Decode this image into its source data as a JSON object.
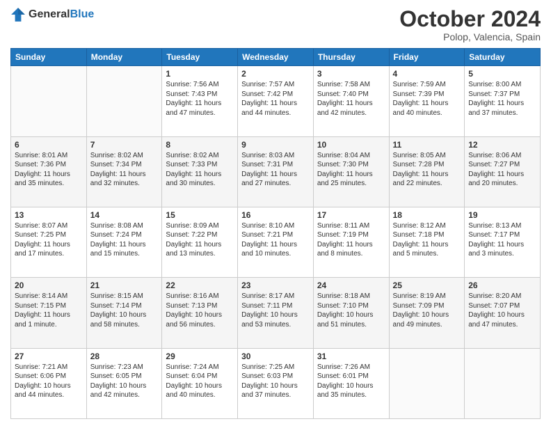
{
  "logo": {
    "text_general": "General",
    "text_blue": "Blue"
  },
  "header": {
    "month": "October 2024",
    "location": "Polop, Valencia, Spain"
  },
  "weekdays": [
    "Sunday",
    "Monday",
    "Tuesday",
    "Wednesday",
    "Thursday",
    "Friday",
    "Saturday"
  ],
  "weeks": [
    [
      {
        "day": "",
        "info": ""
      },
      {
        "day": "",
        "info": ""
      },
      {
        "day": "1",
        "info": "Sunrise: 7:56 AM\nSunset: 7:43 PM\nDaylight: 11 hours and 47 minutes."
      },
      {
        "day": "2",
        "info": "Sunrise: 7:57 AM\nSunset: 7:42 PM\nDaylight: 11 hours and 44 minutes."
      },
      {
        "day": "3",
        "info": "Sunrise: 7:58 AM\nSunset: 7:40 PM\nDaylight: 11 hours and 42 minutes."
      },
      {
        "day": "4",
        "info": "Sunrise: 7:59 AM\nSunset: 7:39 PM\nDaylight: 11 hours and 40 minutes."
      },
      {
        "day": "5",
        "info": "Sunrise: 8:00 AM\nSunset: 7:37 PM\nDaylight: 11 hours and 37 minutes."
      }
    ],
    [
      {
        "day": "6",
        "info": "Sunrise: 8:01 AM\nSunset: 7:36 PM\nDaylight: 11 hours and 35 minutes."
      },
      {
        "day": "7",
        "info": "Sunrise: 8:02 AM\nSunset: 7:34 PM\nDaylight: 11 hours and 32 minutes."
      },
      {
        "day": "8",
        "info": "Sunrise: 8:02 AM\nSunset: 7:33 PM\nDaylight: 11 hours and 30 minutes."
      },
      {
        "day": "9",
        "info": "Sunrise: 8:03 AM\nSunset: 7:31 PM\nDaylight: 11 hours and 27 minutes."
      },
      {
        "day": "10",
        "info": "Sunrise: 8:04 AM\nSunset: 7:30 PM\nDaylight: 11 hours and 25 minutes."
      },
      {
        "day": "11",
        "info": "Sunrise: 8:05 AM\nSunset: 7:28 PM\nDaylight: 11 hours and 22 minutes."
      },
      {
        "day": "12",
        "info": "Sunrise: 8:06 AM\nSunset: 7:27 PM\nDaylight: 11 hours and 20 minutes."
      }
    ],
    [
      {
        "day": "13",
        "info": "Sunrise: 8:07 AM\nSunset: 7:25 PM\nDaylight: 11 hours and 17 minutes."
      },
      {
        "day": "14",
        "info": "Sunrise: 8:08 AM\nSunset: 7:24 PM\nDaylight: 11 hours and 15 minutes."
      },
      {
        "day": "15",
        "info": "Sunrise: 8:09 AM\nSunset: 7:22 PM\nDaylight: 11 hours and 13 minutes."
      },
      {
        "day": "16",
        "info": "Sunrise: 8:10 AM\nSunset: 7:21 PM\nDaylight: 11 hours and 10 minutes."
      },
      {
        "day": "17",
        "info": "Sunrise: 8:11 AM\nSunset: 7:19 PM\nDaylight: 11 hours and 8 minutes."
      },
      {
        "day": "18",
        "info": "Sunrise: 8:12 AM\nSunset: 7:18 PM\nDaylight: 11 hours and 5 minutes."
      },
      {
        "day": "19",
        "info": "Sunrise: 8:13 AM\nSunset: 7:17 PM\nDaylight: 11 hours and 3 minutes."
      }
    ],
    [
      {
        "day": "20",
        "info": "Sunrise: 8:14 AM\nSunset: 7:15 PM\nDaylight: 11 hours and 1 minute."
      },
      {
        "day": "21",
        "info": "Sunrise: 8:15 AM\nSunset: 7:14 PM\nDaylight: 10 hours and 58 minutes."
      },
      {
        "day": "22",
        "info": "Sunrise: 8:16 AM\nSunset: 7:13 PM\nDaylight: 10 hours and 56 minutes."
      },
      {
        "day": "23",
        "info": "Sunrise: 8:17 AM\nSunset: 7:11 PM\nDaylight: 10 hours and 53 minutes."
      },
      {
        "day": "24",
        "info": "Sunrise: 8:18 AM\nSunset: 7:10 PM\nDaylight: 10 hours and 51 minutes."
      },
      {
        "day": "25",
        "info": "Sunrise: 8:19 AM\nSunset: 7:09 PM\nDaylight: 10 hours and 49 minutes."
      },
      {
        "day": "26",
        "info": "Sunrise: 8:20 AM\nSunset: 7:07 PM\nDaylight: 10 hours and 47 minutes."
      }
    ],
    [
      {
        "day": "27",
        "info": "Sunrise: 7:21 AM\nSunset: 6:06 PM\nDaylight: 10 hours and 44 minutes."
      },
      {
        "day": "28",
        "info": "Sunrise: 7:23 AM\nSunset: 6:05 PM\nDaylight: 10 hours and 42 minutes."
      },
      {
        "day": "29",
        "info": "Sunrise: 7:24 AM\nSunset: 6:04 PM\nDaylight: 10 hours and 40 minutes."
      },
      {
        "day": "30",
        "info": "Sunrise: 7:25 AM\nSunset: 6:03 PM\nDaylight: 10 hours and 37 minutes."
      },
      {
        "day": "31",
        "info": "Sunrise: 7:26 AM\nSunset: 6:01 PM\nDaylight: 10 hours and 35 minutes."
      },
      {
        "day": "",
        "info": ""
      },
      {
        "day": "",
        "info": ""
      }
    ]
  ]
}
